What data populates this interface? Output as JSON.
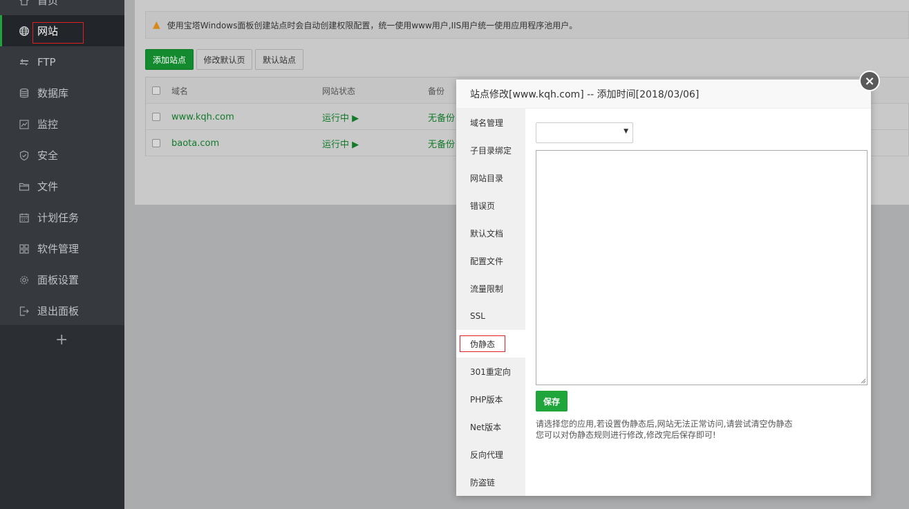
{
  "sidebar": {
    "items": [
      {
        "label": "首页",
        "icon": "home-icon"
      },
      {
        "label": "网站",
        "icon": "globe-icon"
      },
      {
        "label": "FTP",
        "icon": "ftp-icon"
      },
      {
        "label": "数据库",
        "icon": "database-icon"
      },
      {
        "label": "监控",
        "icon": "monitor-icon"
      },
      {
        "label": "安全",
        "icon": "shield-icon"
      },
      {
        "label": "文件",
        "icon": "folder-icon"
      },
      {
        "label": "计划任务",
        "icon": "calendar-icon"
      },
      {
        "label": "软件管理",
        "icon": "apps-icon"
      },
      {
        "label": "面板设置",
        "icon": "gear-icon"
      },
      {
        "label": "退出面板",
        "icon": "logout-icon"
      }
    ],
    "add_symbol": "+"
  },
  "notice": {
    "text": "使用宝塔Windows面板创建站点时会自动创建权限配置，统一使用www用户,IIS用户统一使用应用程序池用户。"
  },
  "toolbar": {
    "add_site": "添加站点",
    "edit_default_page": "修改默认页",
    "default_site": "默认站点"
  },
  "table": {
    "headers": [
      "域名",
      "网站状态",
      "备份"
    ],
    "rows": [
      {
        "domain": "www.kqh.com",
        "status": "运行中 ▶",
        "backup": "无备份"
      },
      {
        "domain": "baota.com",
        "status": "运行中 ▶",
        "backup": "无备份"
      }
    ]
  },
  "modal": {
    "title": "站点修改[www.kqh.com] -- 添加时间[2018/03/06]",
    "close_symbol": "×",
    "tabs": [
      "域名管理",
      "子目录绑定",
      "网站目录",
      "错误页",
      "默认文档",
      "配置文件",
      "流量限制",
      "SSL",
      "伪静态",
      "301重定向",
      "PHP版本",
      "Net版本",
      "反向代理",
      "防盗链"
    ],
    "active_tab": "伪静态",
    "select_value": "",
    "textarea_value": "",
    "save_label": "保存",
    "tip_line1": "请选择您的应用,若设置伪静态后,网站无法正常访问,请尝试清空伪静态",
    "tip_line2": "您可以对伪静态规则进行修改,修改完后保存即可!"
  },
  "colors": {
    "accent_green": "#20a53a",
    "sidebar_bg": "#36393e",
    "highlight_red": "#e02020"
  }
}
